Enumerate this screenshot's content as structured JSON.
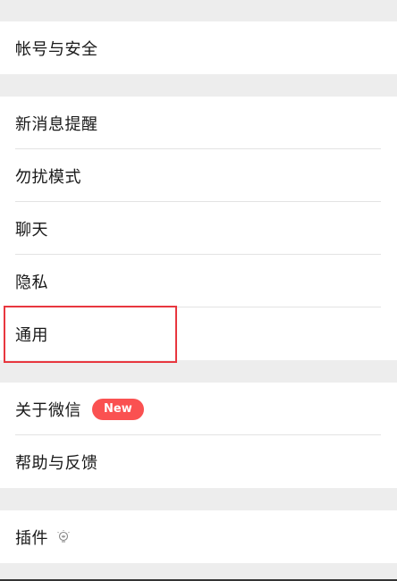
{
  "groups": {
    "account": {
      "label": "帐号与安全"
    },
    "notifications": {
      "items": [
        {
          "label": "新消息提醒"
        },
        {
          "label": "勿扰模式"
        },
        {
          "label": "聊天"
        },
        {
          "label": "隐私"
        },
        {
          "label": "通用"
        }
      ]
    },
    "about": {
      "items": [
        {
          "label": "关于微信",
          "badge": "New"
        },
        {
          "label": "帮助与反馈"
        }
      ]
    },
    "plugins": {
      "label": "插件",
      "icon": "plugin-bulb-icon"
    }
  },
  "colors": {
    "background": "#ededed",
    "badge": "#fa5151",
    "highlight": "#e8373f"
  }
}
